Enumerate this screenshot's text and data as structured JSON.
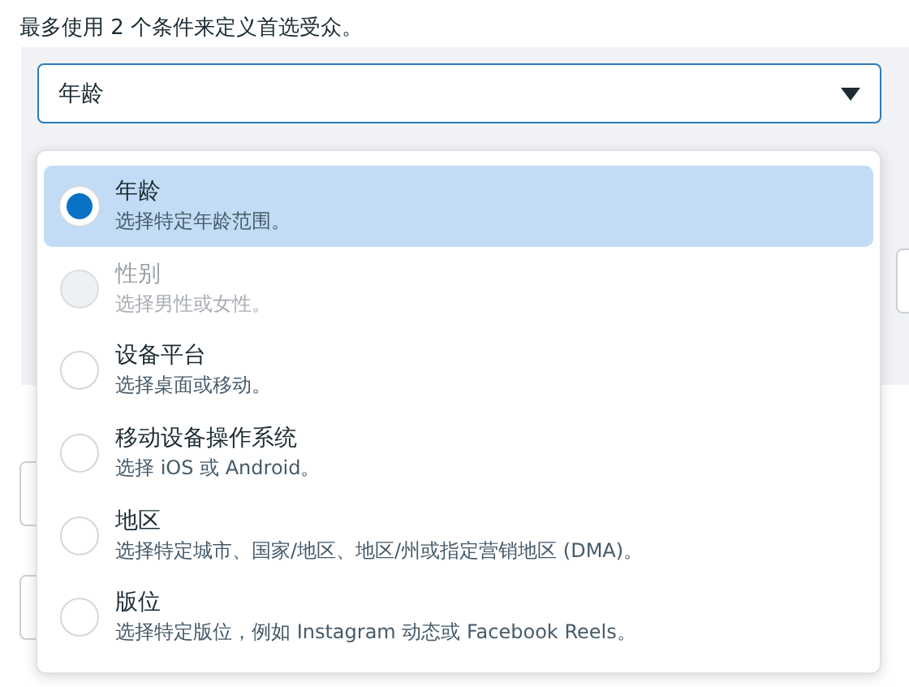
{
  "intro": "最多使用 2 个条件来定义首选受众。",
  "select": {
    "value": "年龄",
    "expanded": true
  },
  "options": [
    {
      "title": "年龄",
      "description": "选择特定年龄范围。",
      "selected": true,
      "disabled": false
    },
    {
      "title": "性别",
      "description": "选择男性或女性。",
      "selected": false,
      "disabled": true
    },
    {
      "title": "设备平台",
      "description": "选择桌面或移动。",
      "selected": false,
      "disabled": false
    },
    {
      "title": "移动设备操作系统",
      "description": "选择 iOS 或 Android。",
      "selected": false,
      "disabled": false
    },
    {
      "title": "地区",
      "description": "选择特定城市、国家/地区、地区/州或指定营销地区 (DMA)。",
      "selected": false,
      "disabled": false
    },
    {
      "title": "版位",
      "description": "选择特定版位，例如 Instagram 动态或 Facebook Reels。",
      "selected": false,
      "disabled": false
    }
  ]
}
